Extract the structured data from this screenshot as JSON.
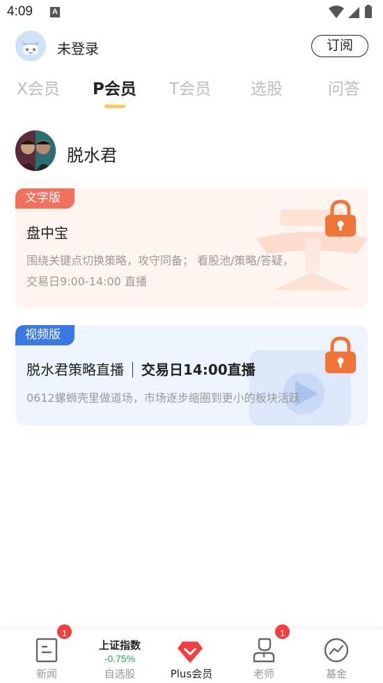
{
  "status_bar": {
    "time": "4:09",
    "notif_letter": "A"
  },
  "header": {
    "login_status": "未登录",
    "subscribe_label": "订阅"
  },
  "tabs": [
    {
      "label": "X会员",
      "active": false
    },
    {
      "label": "P会员",
      "active": true
    },
    {
      "label": "T会员",
      "active": false
    },
    {
      "label": "选股",
      "active": false
    },
    {
      "label": "问答",
      "active": false
    }
  ],
  "author": {
    "name": "脱水君"
  },
  "cards": [
    {
      "badge": "文字版",
      "title": "盘中宝",
      "desc_line1": "围绕关键点切换策略，攻守同备； 看股池/策略/答疑，",
      "desc_line2": "交易日9:00-14:00 直播",
      "locked": true
    },
    {
      "badge": "视频版",
      "title_left": "脱水君策略直播",
      "title_right": "交易日14:00直播",
      "desc": "0612螺蛳壳里做道场，市场逐步缩圈到更小的板块活跃",
      "locked": true
    }
  ],
  "bottom_nav": {
    "news": {
      "label": "新闻",
      "badge": "1"
    },
    "watchlist": {
      "label": "自选股",
      "index_name": "上证指数",
      "index_change": "-0.75%"
    },
    "plus": {
      "label": "Plus会员"
    },
    "teacher": {
      "label": "老师",
      "badge": "1"
    },
    "fund": {
      "label": "基金"
    }
  },
  "colors": {
    "accent_yellow": "#f6c862",
    "badge_orange": "#f2705c",
    "badge_blue": "#3a78e3",
    "lock_orange": "#f07438",
    "plus_red": "#f23e3e",
    "index_green": "#27a55b"
  }
}
